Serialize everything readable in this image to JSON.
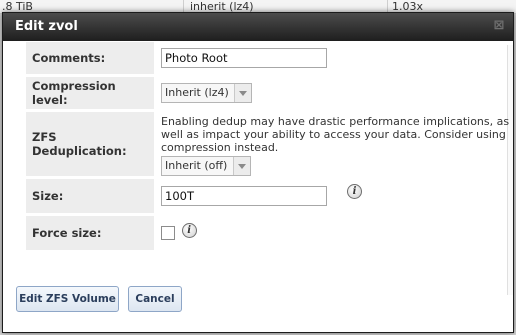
{
  "background_table": {
    "cell_1": ".8 TiB",
    "cell_2": "inherit (lz4)",
    "cell_3": "1.03x"
  },
  "dialog": {
    "title": "Edit zvol",
    "close_glyph": "⊠"
  },
  "form": {
    "comments": {
      "label": "Comments:",
      "value": "Photo Root"
    },
    "compression": {
      "label": "Compression level:",
      "selected": "Inherit (lz4)"
    },
    "dedup": {
      "label": "ZFS Deduplication:",
      "note": "Enabling dedup may have drastic performance implications, as well as impact your ability to access your data. Consider using compression instead.",
      "selected": "Inherit (off)"
    },
    "size": {
      "label": "Size:",
      "value": "100T",
      "help_icon": "info-icon"
    },
    "force_size": {
      "label": "Force size:",
      "checked": false,
      "help_icon": "info-icon"
    }
  },
  "buttons": {
    "submit": "Edit ZFS Volume",
    "cancel": "Cancel"
  },
  "info_glyph": "i"
}
